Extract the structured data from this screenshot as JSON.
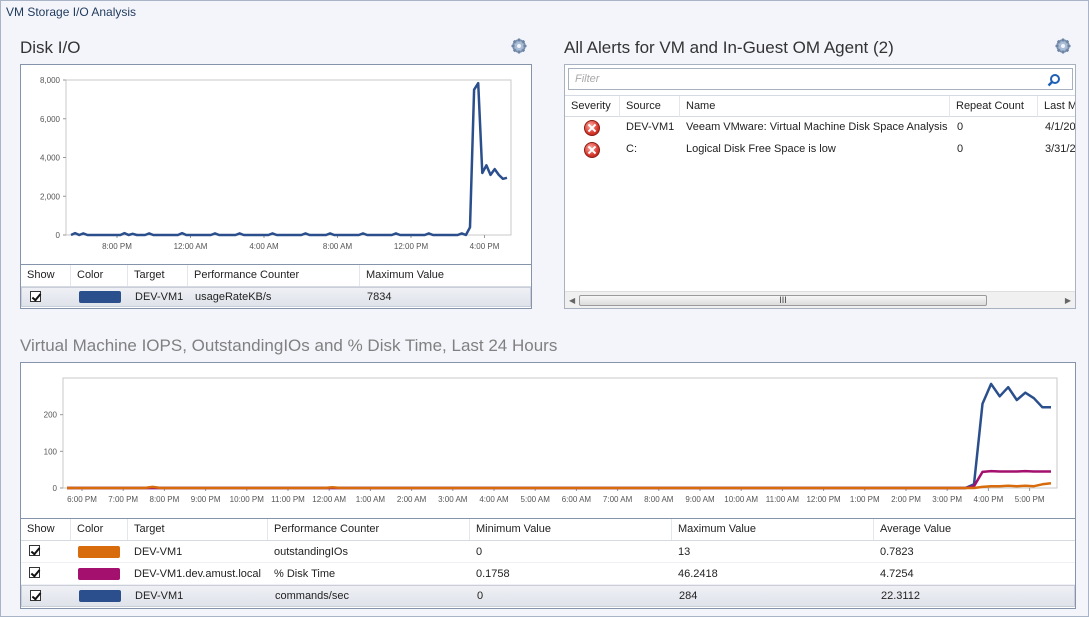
{
  "window": {
    "title": "VM Storage I/O Analysis"
  },
  "disk_io": {
    "title": "Disk I/O",
    "table": {
      "headers": [
        "Show",
        "Color",
        "Target",
        "Performance Counter",
        "Maximum Value"
      ],
      "rows": [
        {
          "target": "DEV-VM1",
          "counter": "usageRateKB/s",
          "max": "7834",
          "color": "#2b4f8c"
        }
      ]
    }
  },
  "alerts": {
    "title": "All Alerts for VM and In-Guest OM Agent (2)",
    "filter_placeholder": "Filter",
    "headers": [
      "Severity",
      "Source",
      "Name",
      "Repeat Count",
      "Last M"
    ],
    "rows": [
      {
        "source": "DEV-VM1",
        "name": "Veeam VMware: Virtual Machine Disk Space Analysis",
        "repeat": "0",
        "last": "4/1/20"
      },
      {
        "source": "C:",
        "name": "Logical Disk Free Space is low",
        "repeat": "0",
        "last": "3/31/2"
      }
    ],
    "scroll_grip": "III"
  },
  "iops": {
    "title": "Virtual Machine IOPS, OutstandingIOs and % Disk Time, Last 24 Hours",
    "table": {
      "headers": [
        "Show",
        "Color",
        "Target",
        "Performance Counter",
        "Minimum Value",
        "Maximum Value",
        "Average Value"
      ],
      "rows": [
        {
          "target": "DEV-VM1",
          "counter": "outstandingIOs",
          "min": "0",
          "max": "13",
          "avg": "0.7823",
          "color": "#d86c0c"
        },
        {
          "target": "DEV-VM1.dev.amust.local",
          "counter": "% Disk Time",
          "min": "0.1758",
          "max": "46.2418",
          "avg": "4.7254",
          "color": "#a4106e"
        },
        {
          "target": "DEV-VM1",
          "counter": "commands/sec",
          "min": "0",
          "max": "284",
          "avg": "22.3112",
          "color": "#2b4f8c"
        }
      ]
    }
  },
  "chart_data": [
    {
      "type": "line",
      "title": "Disk I/O",
      "ylim": [
        0,
        8000
      ],
      "y_ticks": [
        "0",
        "2,000",
        "4,000",
        "6,000",
        "8,000"
      ],
      "x_ticks": [
        "8:00 PM",
        "12:00 AM",
        "4:00 AM",
        "8:00 AM",
        "12:00 PM",
        "4:00 PM"
      ],
      "series": [
        {
          "name": "usageRateKB/s",
          "color": "#2b4f8c",
          "values": [
            0,
            100,
            0,
            80,
            0,
            0,
            0,
            0,
            0,
            0,
            0,
            0,
            0,
            100,
            0,
            60,
            0,
            0,
            0,
            80,
            0,
            0,
            0,
            0,
            0,
            0,
            0,
            100,
            0,
            0,
            0,
            0,
            0,
            0,
            0,
            80,
            0,
            0,
            0,
            0,
            0,
            80,
            0,
            0,
            0,
            0,
            0,
            0,
            0,
            80,
            0,
            0,
            0,
            0,
            0,
            0,
            0,
            80,
            0,
            0,
            0,
            0,
            0,
            80,
            0,
            0,
            0,
            0,
            0,
            0,
            0,
            80,
            0,
            0,
            0,
            0,
            0,
            0,
            0,
            80,
            0,
            0,
            0,
            0,
            0,
            0,
            0,
            80,
            0,
            0,
            0,
            0,
            0,
            0,
            0,
            80,
            0,
            400,
            7500,
            7834,
            3200,
            3600,
            3100,
            3400,
            3100,
            2900,
            2950
          ]
        }
      ]
    },
    {
      "type": "line",
      "title": "Virtual Machine IOPS, OutstandingIOs and % Disk Time, Last 24 Hours",
      "ylim": [
        0,
        300
      ],
      "y_ticks": [
        "0",
        "100",
        "200"
      ],
      "x_ticks": [
        "6:00 PM",
        "7:00 PM",
        "8:00 PM",
        "9:00 PM",
        "10:00 PM",
        "11:00 PM",
        "12:00 AM",
        "1:00 AM",
        "2:00 AM",
        "3:00 AM",
        "4:00 AM",
        "5:00 AM",
        "6:00 AM",
        "7:00 AM",
        "8:00 AM",
        "9:00 AM",
        "10:00 AM",
        "11:00 AM",
        "12:00 PM",
        "1:00 PM",
        "2:00 PM",
        "3:00 PM",
        "4:00 PM",
        "5:00 PM"
      ],
      "series": [
        {
          "name": "commands/sec",
          "color": "#2b4f8c",
          "values": [
            0,
            0,
            0,
            0,
            0,
            0,
            0,
            0,
            0,
            0,
            0,
            0,
            0,
            0,
            0,
            0,
            0,
            0,
            0,
            0,
            0,
            0,
            0,
            0,
            0,
            0,
            0,
            0,
            0,
            0,
            0,
            0,
            0,
            0,
            0,
            0,
            0,
            0,
            0,
            0,
            0,
            0,
            0,
            0,
            0,
            0,
            0,
            0,
            0,
            0,
            0,
            0,
            0,
            0,
            0,
            0,
            0,
            0,
            0,
            0,
            0,
            0,
            0,
            0,
            0,
            0,
            0,
            0,
            0,
            0,
            0,
            0,
            0,
            0,
            0,
            0,
            0,
            0,
            0,
            0,
            0,
            0,
            0,
            0,
            0,
            0,
            0,
            0,
            0,
            0,
            0,
            0,
            0,
            0,
            0,
            0,
            0,
            0,
            0,
            0,
            0,
            0,
            0,
            0,
            0,
            0,
            10,
            230,
            284,
            250,
            275,
            240,
            260,
            245,
            220,
            220
          ]
        },
        {
          "name": "% Disk Time",
          "color": "#a4106e",
          "values": [
            0,
            0,
            0,
            0,
            0,
            0,
            0,
            0,
            0,
            0,
            0,
            0,
            0,
            0,
            0,
            0,
            0,
            0,
            0,
            0,
            0,
            0,
            0,
            0,
            0,
            0,
            0,
            0,
            0,
            0,
            0,
            0,
            0,
            0,
            0,
            0,
            0,
            0,
            0,
            0,
            0,
            0,
            0,
            0,
            0,
            0,
            0,
            0,
            0,
            0,
            0,
            0,
            0,
            0,
            0,
            0,
            0,
            0,
            0,
            0,
            0,
            0,
            0,
            0,
            0,
            0,
            0,
            0,
            0,
            0,
            0,
            0,
            0,
            0,
            0,
            0,
            0,
            0,
            0,
            0,
            0,
            0,
            0,
            0,
            0,
            0,
            0,
            0,
            0,
            0,
            0,
            0,
            0,
            0,
            0,
            0,
            0,
            0,
            0,
            0,
            0,
            0,
            0,
            0,
            0,
            0,
            5,
            44,
            46,
            45,
            45,
            45,
            46,
            45,
            45,
            45
          ]
        },
        {
          "name": "outstandingIOs",
          "color": "#d86c0c",
          "values": [
            0,
            0,
            0,
            0,
            0,
            0,
            0,
            0,
            0,
            0,
            3,
            0,
            0,
            0,
            0,
            0,
            0,
            0,
            0,
            0,
            0,
            0,
            0,
            0,
            0,
            0,
            0,
            0,
            0,
            0,
            0,
            2,
            0,
            0,
            0,
            0,
            0,
            0,
            0,
            0,
            0,
            0,
            0,
            0,
            0,
            0,
            0,
            0,
            0,
            0,
            0,
            0,
            0,
            0,
            0,
            0,
            0,
            0,
            0,
            0,
            0,
            0,
            0,
            0,
            0,
            0,
            0,
            0,
            0,
            0,
            0,
            0,
            0,
            0,
            0,
            0,
            0,
            0,
            0,
            0,
            0,
            0,
            0,
            0,
            0,
            0,
            0,
            0,
            0,
            0,
            0,
            0,
            0,
            0,
            0,
            0,
            0,
            0,
            0,
            0,
            0,
            0,
            0,
            0,
            0,
            0,
            0,
            3,
            5,
            5,
            6,
            5,
            6,
            5,
            10,
            13
          ]
        }
      ]
    }
  ]
}
